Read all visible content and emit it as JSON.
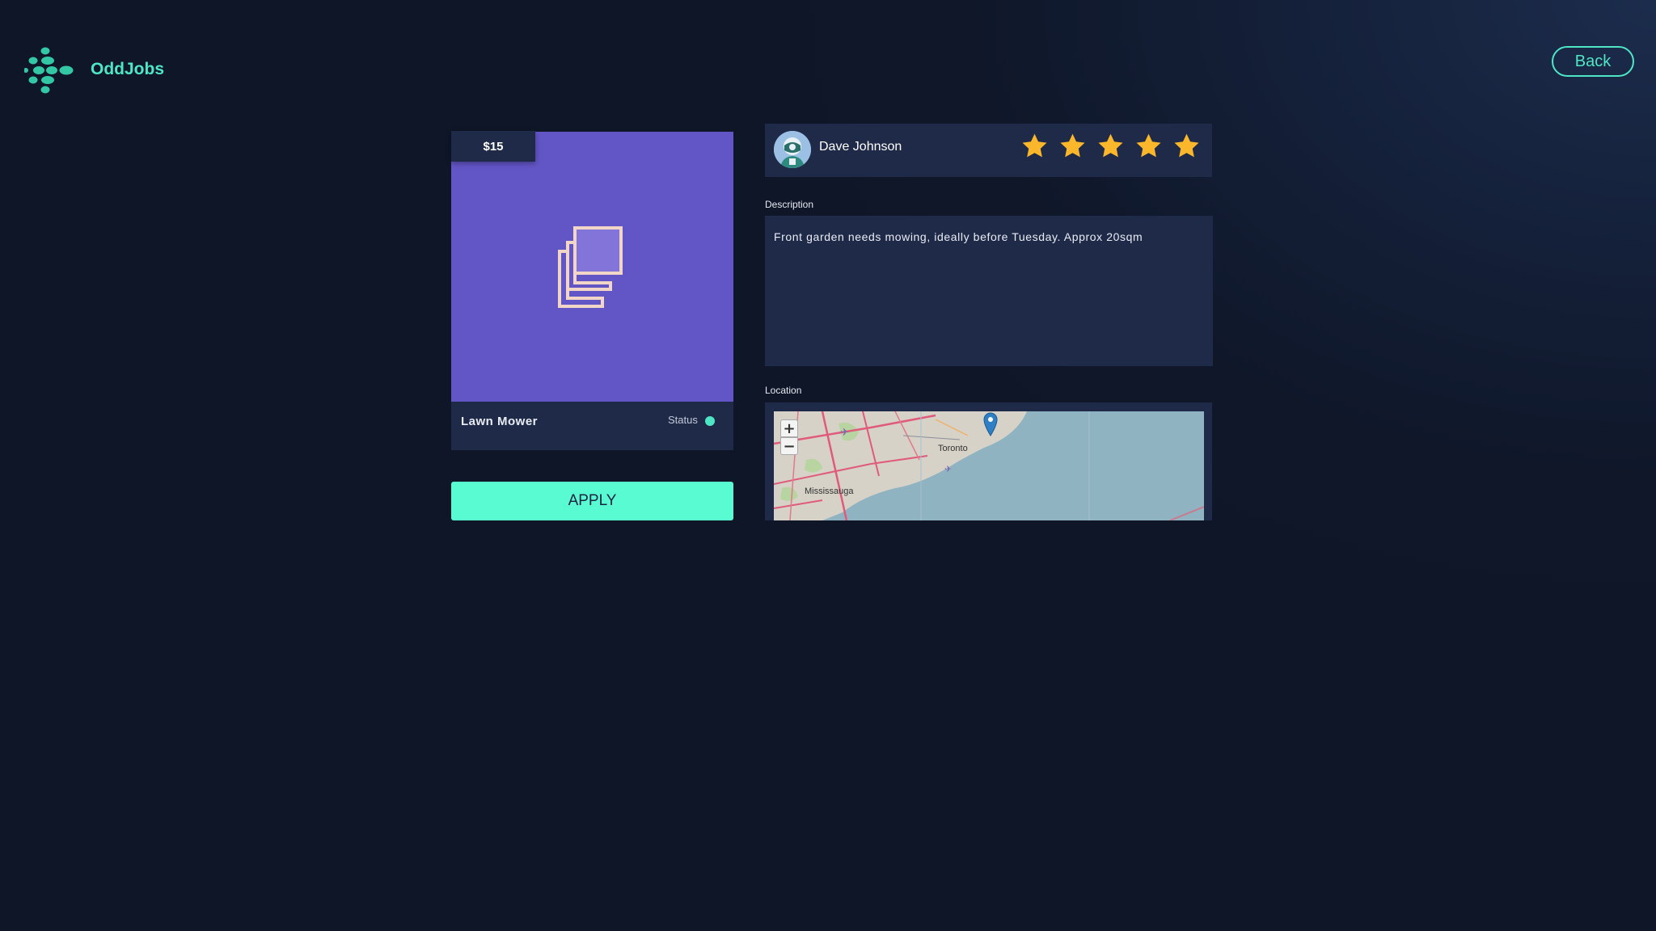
{
  "app": {
    "name": "OddJobs",
    "logo_icon": "oddjobs-logo-icon",
    "accent_color": "#4ee6c4"
  },
  "header": {
    "back_label": "Back"
  },
  "job": {
    "price": "$15",
    "title": "Lawn Mower",
    "status_label": "Status",
    "status_color": "#4ee6c4",
    "image_placeholder_icon": "image-gallery-icon",
    "image_background": "#6255c5",
    "apply_label": "APPLY"
  },
  "poster": {
    "name": "Dave Johnson",
    "avatar_icon": "user-avatar",
    "rating": 5,
    "rating_max": 5,
    "star_color": "#fbb72b"
  },
  "description": {
    "label": "Description",
    "text": "Front garden needs mowing, ideally before Tuesday. Approx 20sqm"
  },
  "location": {
    "label": "Location",
    "zoom_in": "+",
    "zoom_out": "−",
    "labels": [
      "Toronto",
      "Mississauga"
    ]
  }
}
